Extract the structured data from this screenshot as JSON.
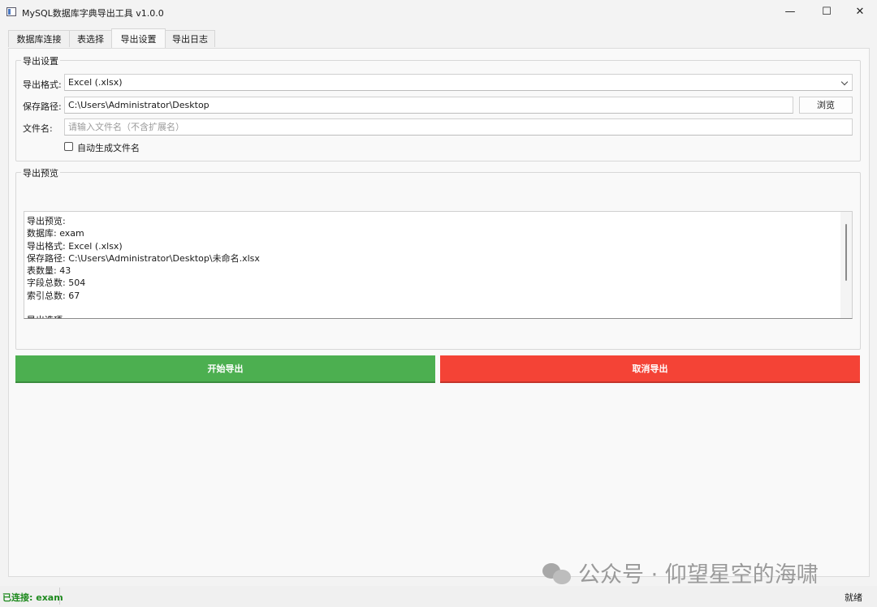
{
  "window": {
    "title": "MySQL数据库字典导出工具 v1.0.0",
    "minimize_glyph": "—",
    "maximize_glyph": "☐",
    "close_glyph": "✕"
  },
  "tabs": [
    {
      "label": "数据库连接",
      "active": false
    },
    {
      "label": "表选择",
      "active": false
    },
    {
      "label": "导出设置",
      "active": true
    },
    {
      "label": "导出日志",
      "active": false
    }
  ],
  "export_settings": {
    "group_title": "导出设置",
    "format_label": "导出格式:",
    "format_value": "Excel (.xlsx)",
    "path_label": "保存路径:",
    "path_value": "C:\\Users\\Administrator\\Desktop",
    "browse_label": "浏览",
    "filename_label": "文件名:",
    "filename_placeholder": "请输入文件名（不含扩展名）",
    "auto_name_label": "自动生成文件名",
    "auto_name_checked": false
  },
  "preview": {
    "group_title": "导出预览",
    "text": "导出预览:\n数据库: exam\n导出格式: Excel (.xlsx)\n保存路径: C:\\Users\\Administrator\\Desktop\\未命名.xlsx\n表数量: 43\n字段总数: 504\n索引总数: 67\n\n导出选项:"
  },
  "actions": {
    "start_label": "开始导出",
    "cancel_label": "取消导出",
    "start_color": "#4caf50",
    "cancel_color": "#f44336"
  },
  "watermark": {
    "text": "公众号 · 仰望星空的海啸"
  },
  "status": {
    "connection": "已连接: exam",
    "state": "就绪"
  }
}
